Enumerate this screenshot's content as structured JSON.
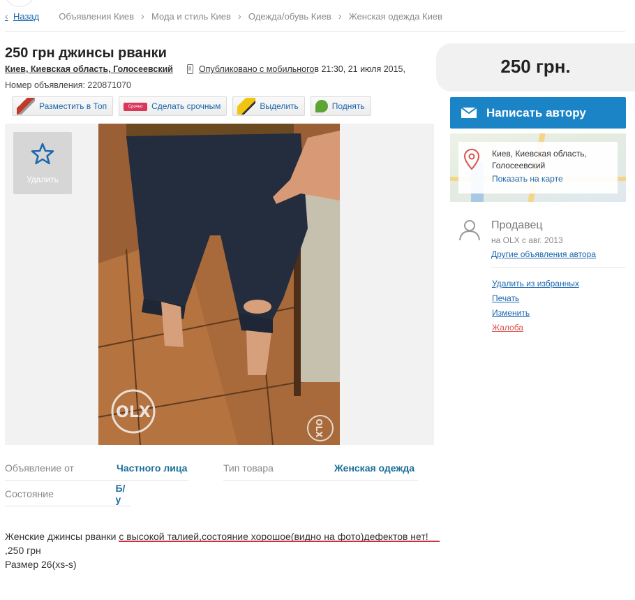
{
  "breadcrumb": {
    "back_label": "Назад",
    "items": [
      "Объявления Киев",
      "Мода и стиль Киев",
      "Одежда/обувь Киев",
      "Женская одежда Киев"
    ]
  },
  "ad": {
    "title": "250 грн джинсы рванки",
    "location": "Киев, Киевская область, Голосеевский",
    "published_link": "Опубликовано с мобильного",
    "published_rest": " в 21:30, 21 июля 2015,",
    "number": "Номер объявления: 220871070"
  },
  "actions": [
    {
      "label": "Разместить в Топ",
      "icon": "rocket-icon"
    },
    {
      "label": "Сделать срочным",
      "icon": "urgent-tag-icon",
      "icon_text": "Срочно"
    },
    {
      "label": "Выделить",
      "icon": "highlighter-icon"
    },
    {
      "label": "Поднять",
      "icon": "leaf-arrow-icon"
    }
  ],
  "favorite": {
    "label": "Удалить",
    "icon": "star-icon"
  },
  "photo": {
    "watermark": "OLX"
  },
  "details": {
    "from_label": "Объявление от",
    "from_value": "Частного лица",
    "type_label": "Тип товара",
    "type_value": "Женская одежда",
    "condition_label": "Состояние",
    "condition_value": "Б/у"
  },
  "description": {
    "line1_a": "Женские джинсы рванки ",
    "line1_b": "с высокой талией,состояние хорошое(видно на фото)дефектов нет!",
    "line2": ",250 грн",
    "line3": "Размер 26(xs-s)"
  },
  "sidebar": {
    "price": "250 грн.",
    "contact_label": "Написать автору",
    "map_address_1": "Киев, Киевская область,",
    "map_address_2": "Голосеевский",
    "map_link": "Показать на карте",
    "seller_title": "Продавец",
    "seller_since": "на OLX с авг. 2013",
    "seller_other_ads": "Другие объявления автора",
    "links": [
      "Удалить из избранных",
      "Печать",
      "Изменить",
      "Жалоба"
    ]
  },
  "colors": {
    "link": "#1b67ad",
    "contact_button": "#1a84c7",
    "complaint": "#d9534f",
    "detail_value": "#1a6e9a",
    "description_underline": "#c8343a"
  }
}
